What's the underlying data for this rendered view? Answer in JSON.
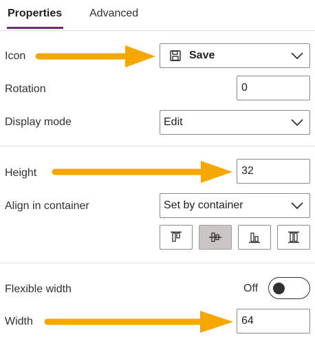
{
  "tabs": [
    {
      "label": "Properties",
      "active": true
    },
    {
      "label": "Advanced",
      "active": false
    }
  ],
  "icon_row": {
    "label": "Icon",
    "value": "Save",
    "icon": "save-floppy-icon"
  },
  "rotation_row": {
    "label": "Rotation",
    "value": "0"
  },
  "display_mode_row": {
    "label": "Display mode",
    "value": "Edit"
  },
  "height_row": {
    "label": "Height",
    "value": "32"
  },
  "align_row": {
    "label": "Align in container",
    "value": "Set by container",
    "buttons": [
      {
        "name": "align-top-icon",
        "selected": false
      },
      {
        "name": "align-center-icon",
        "selected": true
      },
      {
        "name": "align-bottom-icon",
        "selected": false
      },
      {
        "name": "align-stretch-icon",
        "selected": false
      }
    ]
  },
  "flexible_width_row": {
    "label": "Flexible width",
    "state": "Off"
  },
  "width_row": {
    "label": "Width",
    "value": "64"
  },
  "colors": {
    "accent": "#742774",
    "arrow": "#f5a700",
    "border": "#8a8886"
  }
}
